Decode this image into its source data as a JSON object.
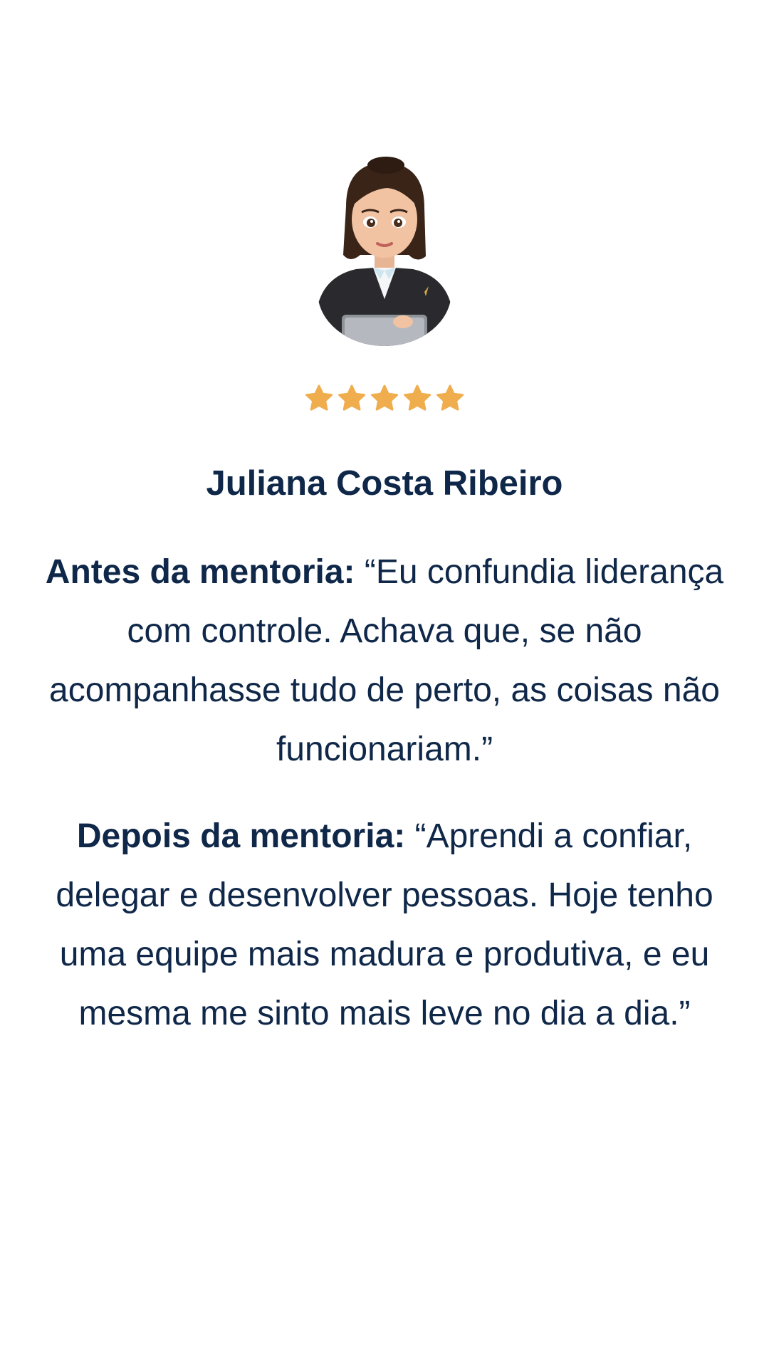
{
  "testimonial": {
    "rating": 5,
    "rating_max": 5,
    "star_color": "#f0ad4e",
    "name": "Juliana Costa Ribeiro",
    "before": {
      "label": "Antes da mentoria:",
      "text": "“Eu confundia liderança com controle. Achava que, se não acompanhasse tudo de perto, as coisas não funcionariam.”"
    },
    "after": {
      "label": "Depois da mentoria:",
      "text": "“Aprendi a confiar, delegar e desenvolver pessoas. Hoje tenho uma equipe mais madura e produtiva, e eu mesma me sinto mais leve no dia a dia.”"
    }
  },
  "icons": {
    "avatar": "avatar-illustration-businesswoman",
    "star": "star-icon"
  },
  "colors": {
    "text": "#0f2748",
    "background": "#ffffff"
  }
}
